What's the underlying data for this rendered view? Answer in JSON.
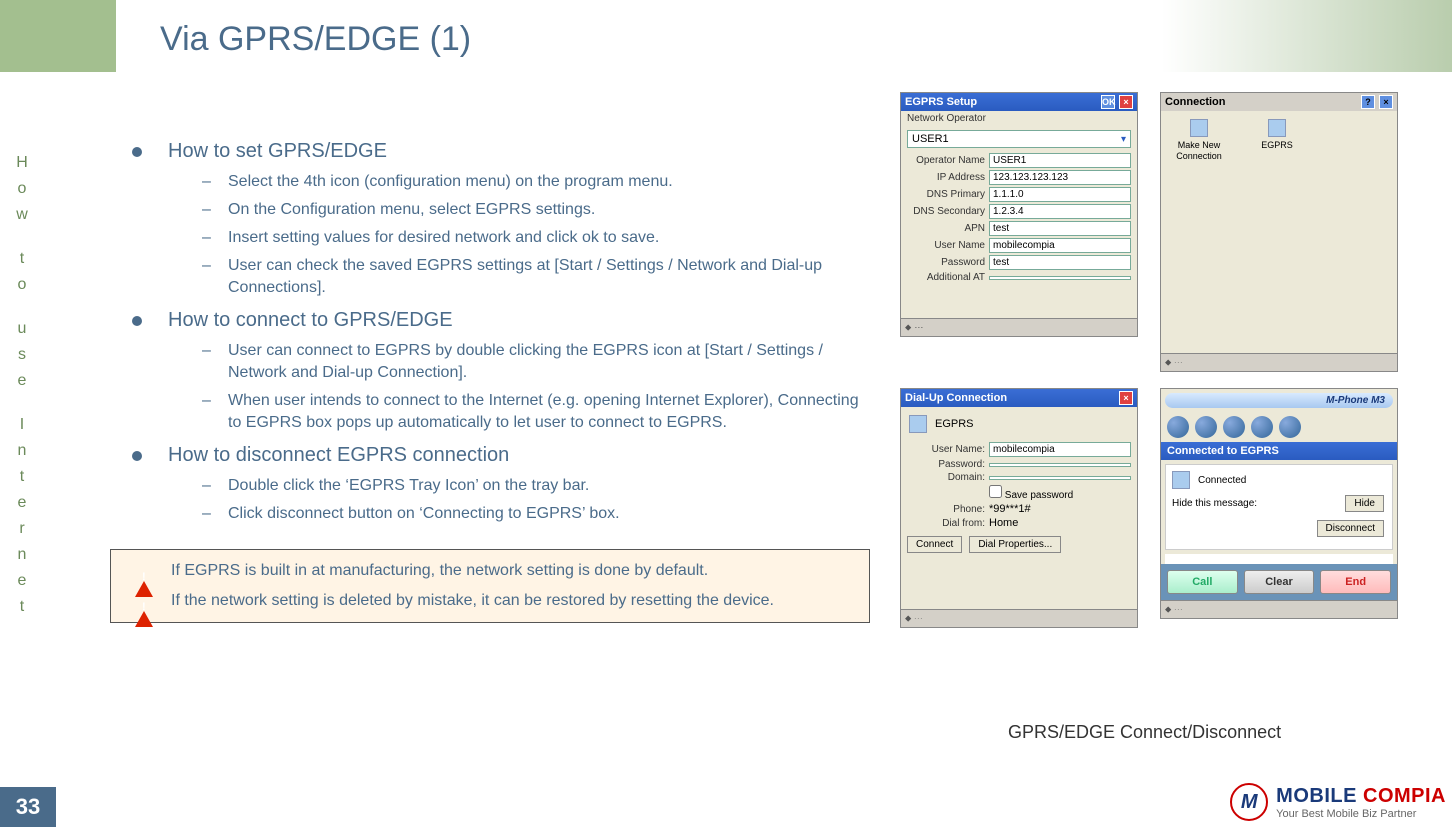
{
  "page": {
    "title": "Via GPRS/EDGE (1)",
    "side_label": "How to use Internet",
    "number": "33"
  },
  "sections": [
    {
      "heading": "How to set GPRS/EDGE",
      "items": [
        "Select the 4th icon (configuration menu) on the program menu.",
        "On the Configuration menu, select EGPRS settings.",
        "Insert setting values for desired network and click ok to save.",
        "User can check the saved EGPRS settings at [Start / Settings / Network and Dial-up Connections]."
      ]
    },
    {
      "heading": "How to connect to GPRS/EDGE",
      "items": [
        "User can connect to EGPRS by double clicking the EGPRS icon at [Start / Settings / Network and Dial-up Connection].",
        "When user intends to connect to the Internet (e.g. opening Internet Explorer), Connecting to EGPRS box pops up automatically to let user to connect to EGPRS."
      ]
    },
    {
      "heading": "How to disconnect EGPRS connection",
      "items": [
        "Double click the ‘EGPRS Tray Icon’ on the tray bar.",
        "Click disconnect button on ‘Connecting to EGPRS’ box."
      ]
    }
  ],
  "notes": [
    "If EGPRS is built in at manufacturing, the network setting is done by default.",
    "If the network setting is deleted by mistake, it can be restored by resetting the device."
  ],
  "egprs_setup": {
    "title": "EGPRS Setup",
    "ok": "OK",
    "operator_label": "Network Operator",
    "operator_value": "USER1",
    "fields": {
      "operator_name": {
        "label": "Operator Name",
        "value": "USER1"
      },
      "ip": {
        "label": "IP Address",
        "value": "123.123.123.123"
      },
      "dns1": {
        "label": "DNS Primary",
        "value": "1.1.1.0"
      },
      "dns2": {
        "label": "DNS Secondary",
        "value": "1.2.3.4"
      },
      "apn": {
        "label": "APN",
        "value": "test"
      },
      "user": {
        "label": "User Name",
        "value": "mobilecompia"
      },
      "pass": {
        "label": "Password",
        "value": "test"
      },
      "at": {
        "label": "Additional AT",
        "value": ""
      }
    }
  },
  "connection_window": {
    "title": "Connection",
    "make_new": "Make New Connection",
    "egprs": "EGPRS"
  },
  "dialup": {
    "title": "Dial-Up Connection",
    "name": "EGPRS",
    "user_label": "User Name:",
    "user_value": "mobilecompia",
    "pass_label": "Password:",
    "domain_label": "Domain:",
    "save_pw": "Save password",
    "phone_label": "Phone:",
    "phone_value": "*99***1#",
    "from_label": "Dial from:",
    "from_value": "Home",
    "connect": "Connect",
    "dial_props": "Dial Properties..."
  },
  "mphone": {
    "brand": "M-Phone M3",
    "banner": "Connected to EGPRS",
    "status": "Connected",
    "hide_label": "Hide this message:",
    "hide": "Hide",
    "disconnect": "Disconnect",
    "call": "Call",
    "clear": "Clear",
    "end": "End"
  },
  "caption": "GPRS/EDGE Connect/Disconnect",
  "logo": {
    "main1": "MOBILE ",
    "main2": "COMPIA",
    "sub": "Your Best Mobile Biz Partner"
  }
}
